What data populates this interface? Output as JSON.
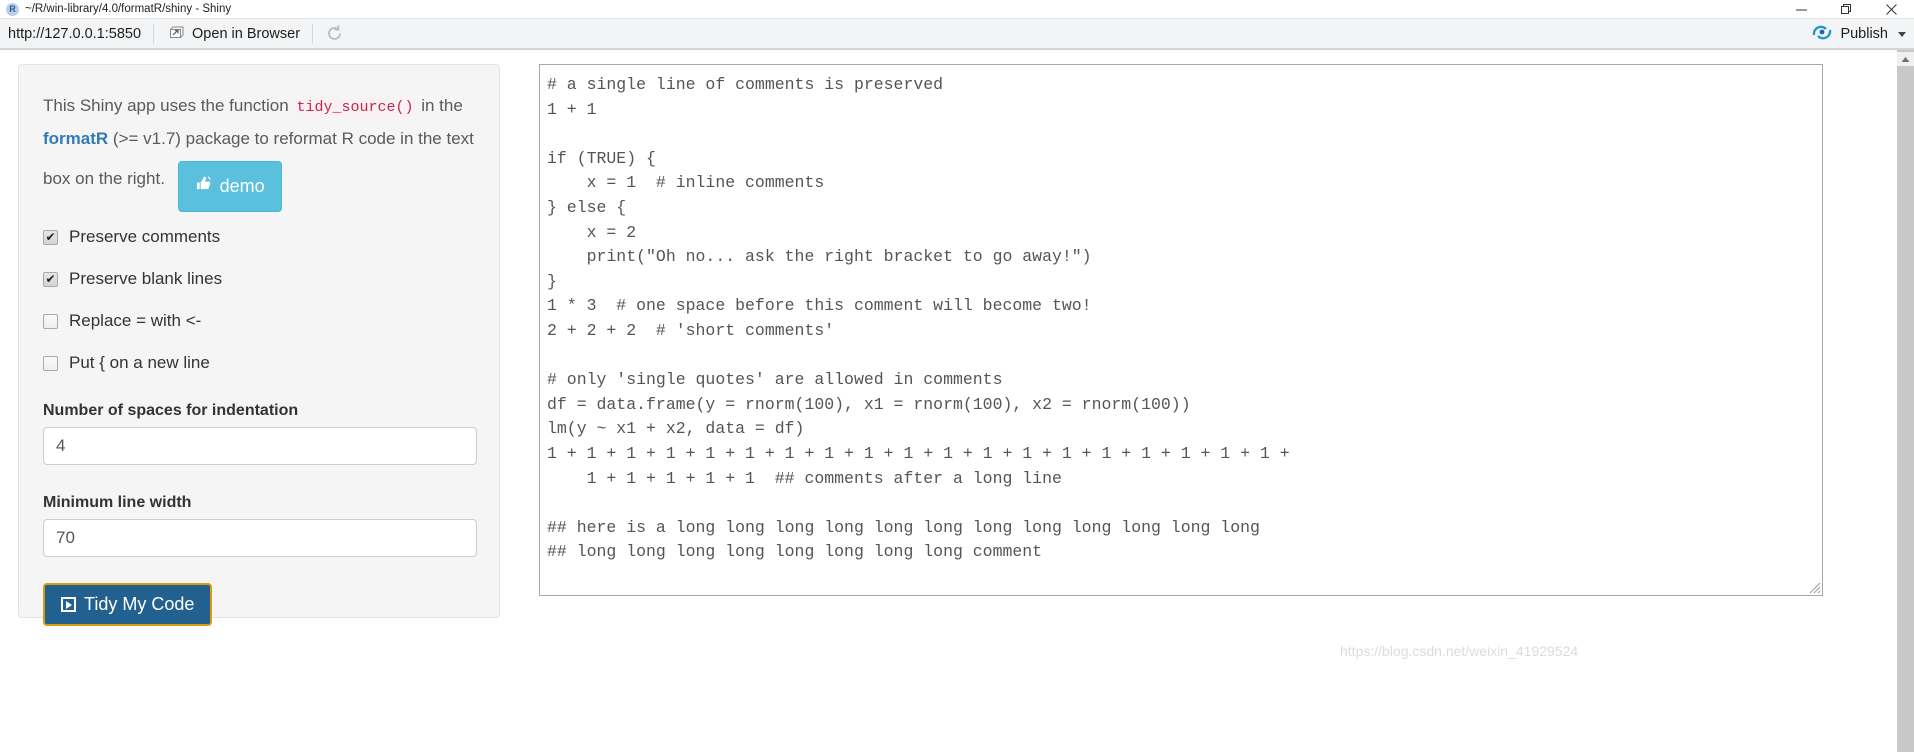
{
  "window": {
    "title": "~/R/win-library/4.0/formatR/shiny - Shiny",
    "logo_letter": "R",
    "minimize_label": "─",
    "maximize_label": "❐",
    "close_label": "✕"
  },
  "toolbar": {
    "url": "http://127.0.0.1:5850",
    "open_in_browser": "Open in Browser",
    "refresh_icon": "refresh-icon",
    "publish_label": "Publish"
  },
  "sidebar": {
    "intro": {
      "part1": "This Shiny app uses the function",
      "code": "tidy_source()",
      "part2": "in the",
      "brand": "formatR",
      "part3": "(>= v1.7) package to reformat R code in the",
      "part4": "text box on the right."
    },
    "demo_button": "demo",
    "checkboxes": [
      {
        "label": "Preserve comments",
        "checked": true
      },
      {
        "label": "Preserve blank lines",
        "checked": true
      },
      {
        "label": "Replace = with <-",
        "checked": false
      },
      {
        "label": "Put { on a new line",
        "checked": false
      }
    ],
    "fields": [
      {
        "label": "Number of spaces for indentation",
        "value": "4",
        "placeholder": ""
      },
      {
        "label": "Minimum line width",
        "value": "70",
        "placeholder": ""
      }
    ],
    "submit_button": "Tidy My Code"
  },
  "editor": {
    "code": "# a single line of comments is preserved\n1 + 1\n\nif (TRUE) {\n    x = 1  # inline comments\n} else {\n    x = 2\n    print(\"Oh no... ask the right bracket to go away!\")\n}\n1 * 3  # one space before this comment will become two!\n2 + 2 + 2  # 'short comments'\n\n# only 'single quotes' are allowed in comments\ndf = data.frame(y = rnorm(100), x1 = rnorm(100), x2 = rnorm(100))\nlm(y ~ x1 + x2, data = df)\n1 + 1 + 1 + 1 + 1 + 1 + 1 + 1 + 1 + 1 + 1 + 1 + 1 + 1 + 1 + 1 + 1 + 1 + 1 +\n    1 + 1 + 1 + 1 + 1  ## comments after a long line\n\n## here is a long long long long long long long long long long long long\n## long long long long long long long long comment"
  },
  "watermark": "https://blog.csdn.net/weixin_41929524",
  "colors": {
    "demo_button_bg": "#5bc0de",
    "submit_button_bg": "#22618f",
    "submit_button_border": "#d99b10",
    "brand_link": "#337ab7",
    "inline_code": "#c7254e",
    "well_bg": "#f5f5f5"
  }
}
